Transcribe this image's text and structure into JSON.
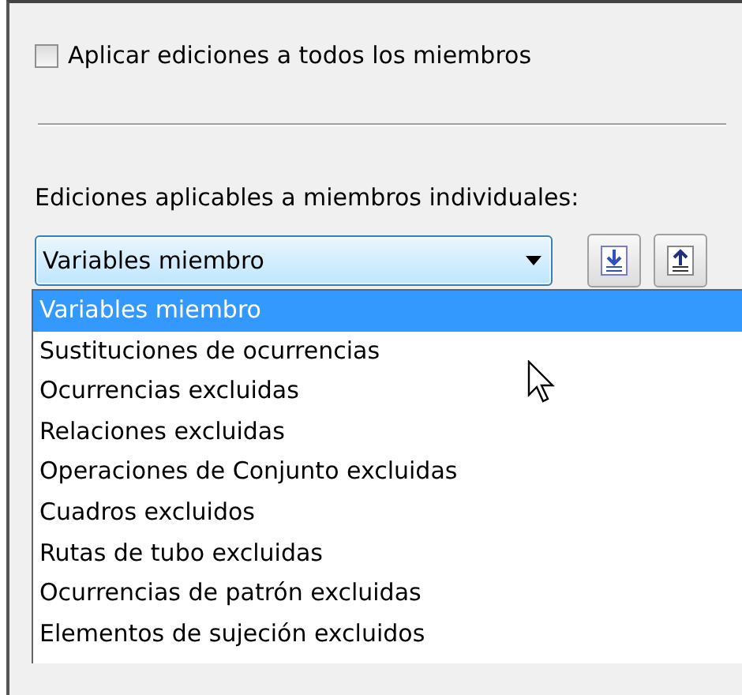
{
  "apply_all": {
    "label": "Aplicar ediciones a todos los miembros",
    "checked": false
  },
  "individual_label": "Ediciones aplicables a miembros individuales:",
  "combo": {
    "value": "Variables miembro",
    "expanded": true
  },
  "dropdown_items": [
    {
      "label": "Variables miembro",
      "selected": true
    },
    {
      "label": "Sustituciones de ocurrencias",
      "selected": false
    },
    {
      "label": "Ocurrencias excluidas",
      "selected": false
    },
    {
      "label": "Relaciones excluidas",
      "selected": false
    },
    {
      "label": "Operaciones de Conjunto excluidas",
      "selected": false
    },
    {
      "label": "Cuadros excluidos",
      "selected": false
    },
    {
      "label": "Rutas de tubo excluidas",
      "selected": false
    },
    {
      "label": "Ocurrencias de patrón excluidas",
      "selected": false
    },
    {
      "label": "Elementos de sujeción excluidos",
      "selected": false
    }
  ]
}
